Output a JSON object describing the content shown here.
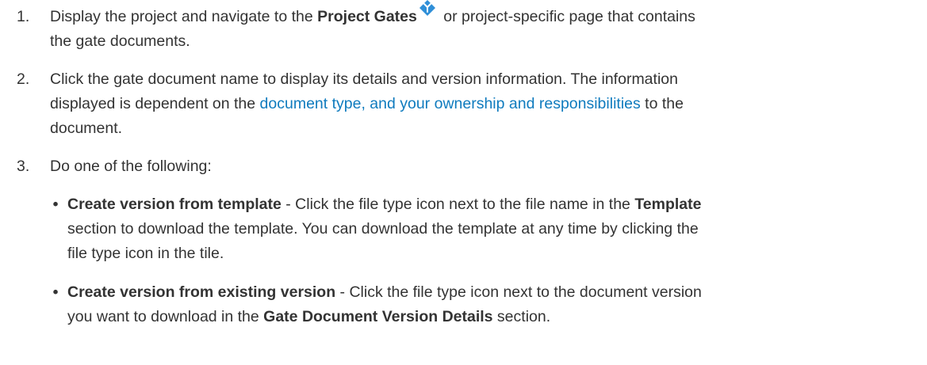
{
  "steps": [
    {
      "number": "1.",
      "text_before": "Display the project and navigate to the ",
      "bold": "Project Gates",
      "icon": "project-gates-diamond-icon",
      "text_after": " or project-specific page that contains",
      "line2": "the gate documents."
    },
    {
      "number": "2.",
      "line1": "Click the gate document name to display its details and version information. The information",
      "line2_before": "displayed is dependent on the ",
      "link": "document type, and your ownership and responsibilities",
      "line2_after": " to the",
      "line3": "document."
    },
    {
      "number": "3.",
      "text": "Do one of the following:",
      "bullets": [
        {
          "glyph": "•",
          "bold": "Create version from template",
          "line1_after": " - Click the file type icon next to the file name in the ",
          "bold2": "Template",
          "line2": "section to download the template. You can download the template at any time by clicking the",
          "line3": "file type icon in the tile."
        },
        {
          "glyph": "•",
          "bold": "Create version from existing version",
          "line1_after": " - Click the file type icon next to the document version",
          "line2_before": "you want to download in the ",
          "bold2": "Gate Document Version Details",
          "line2_after": " section."
        }
      ]
    }
  ],
  "colors": {
    "text": "#333333",
    "link": "#0f7bbe",
    "icon_fill": "#2f8fd8"
  }
}
